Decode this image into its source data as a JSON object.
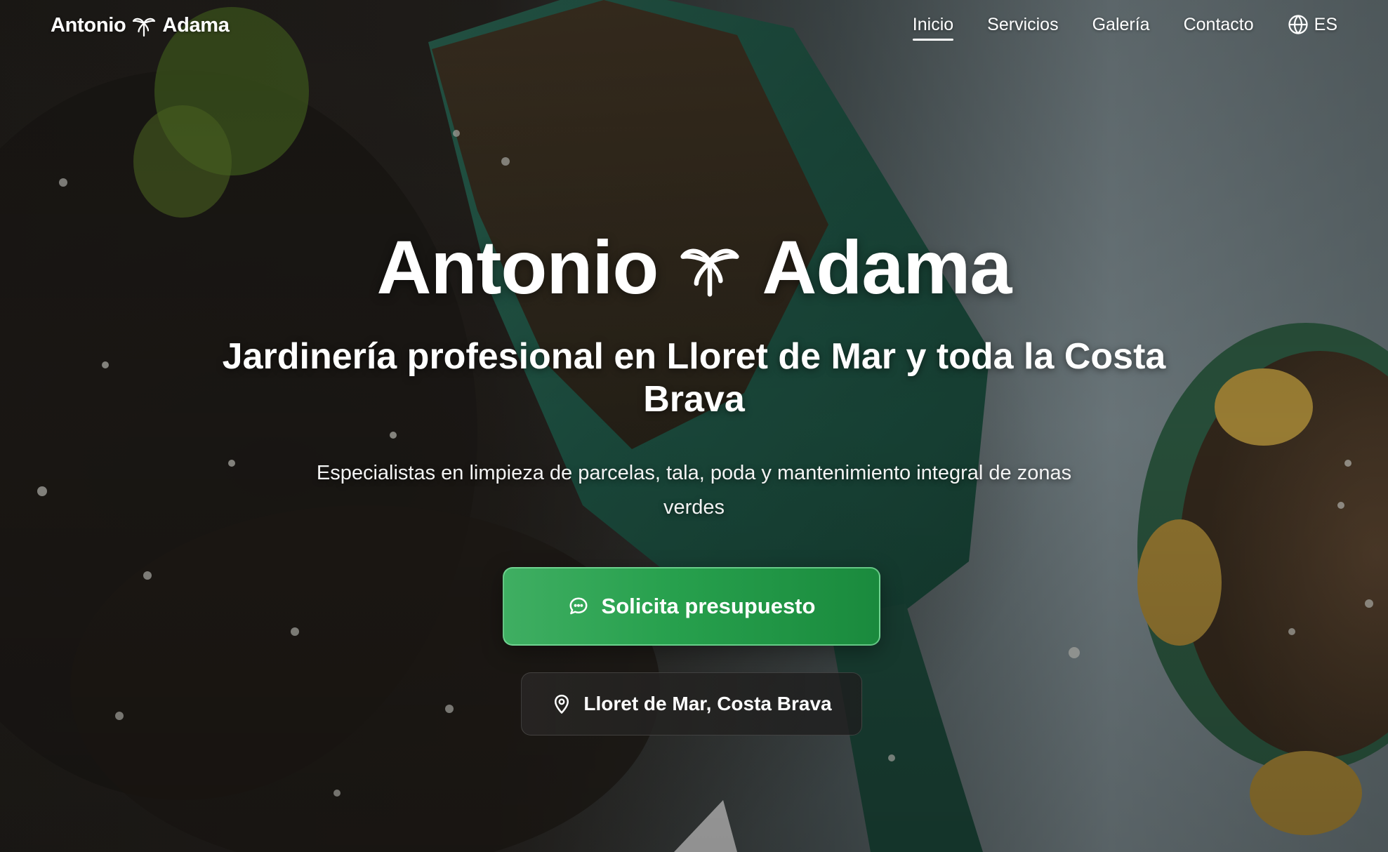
{
  "brand": {
    "name_first": "Antonio",
    "name_last": "Adama",
    "logo_icon": "palm-tree-icon"
  },
  "nav": {
    "items": [
      {
        "label": "Inicio",
        "active": true
      },
      {
        "label": "Servicios",
        "active": false
      },
      {
        "label": "Galería",
        "active": false
      },
      {
        "label": "Contacto",
        "active": false
      }
    ],
    "language": {
      "label": "ES",
      "icon": "globe-icon"
    }
  },
  "hero": {
    "title_first": "Antonio",
    "title_last": "Adama",
    "subtitle": "Jardinería profesional en Lloret de Mar y toda la Costa Brava",
    "description": "Especialistas en limpieza de parcelas, tala, poda y mantenimiento integral de zonas verdes",
    "cta": {
      "label": "Solicita presupuesto",
      "icon": "chat-icon"
    },
    "location": {
      "label": "Lloret de Mar, Costa Brava",
      "icon": "map-pin-icon"
    }
  },
  "colors": {
    "cta_green": "#27a04d",
    "text": "#ffffff"
  }
}
